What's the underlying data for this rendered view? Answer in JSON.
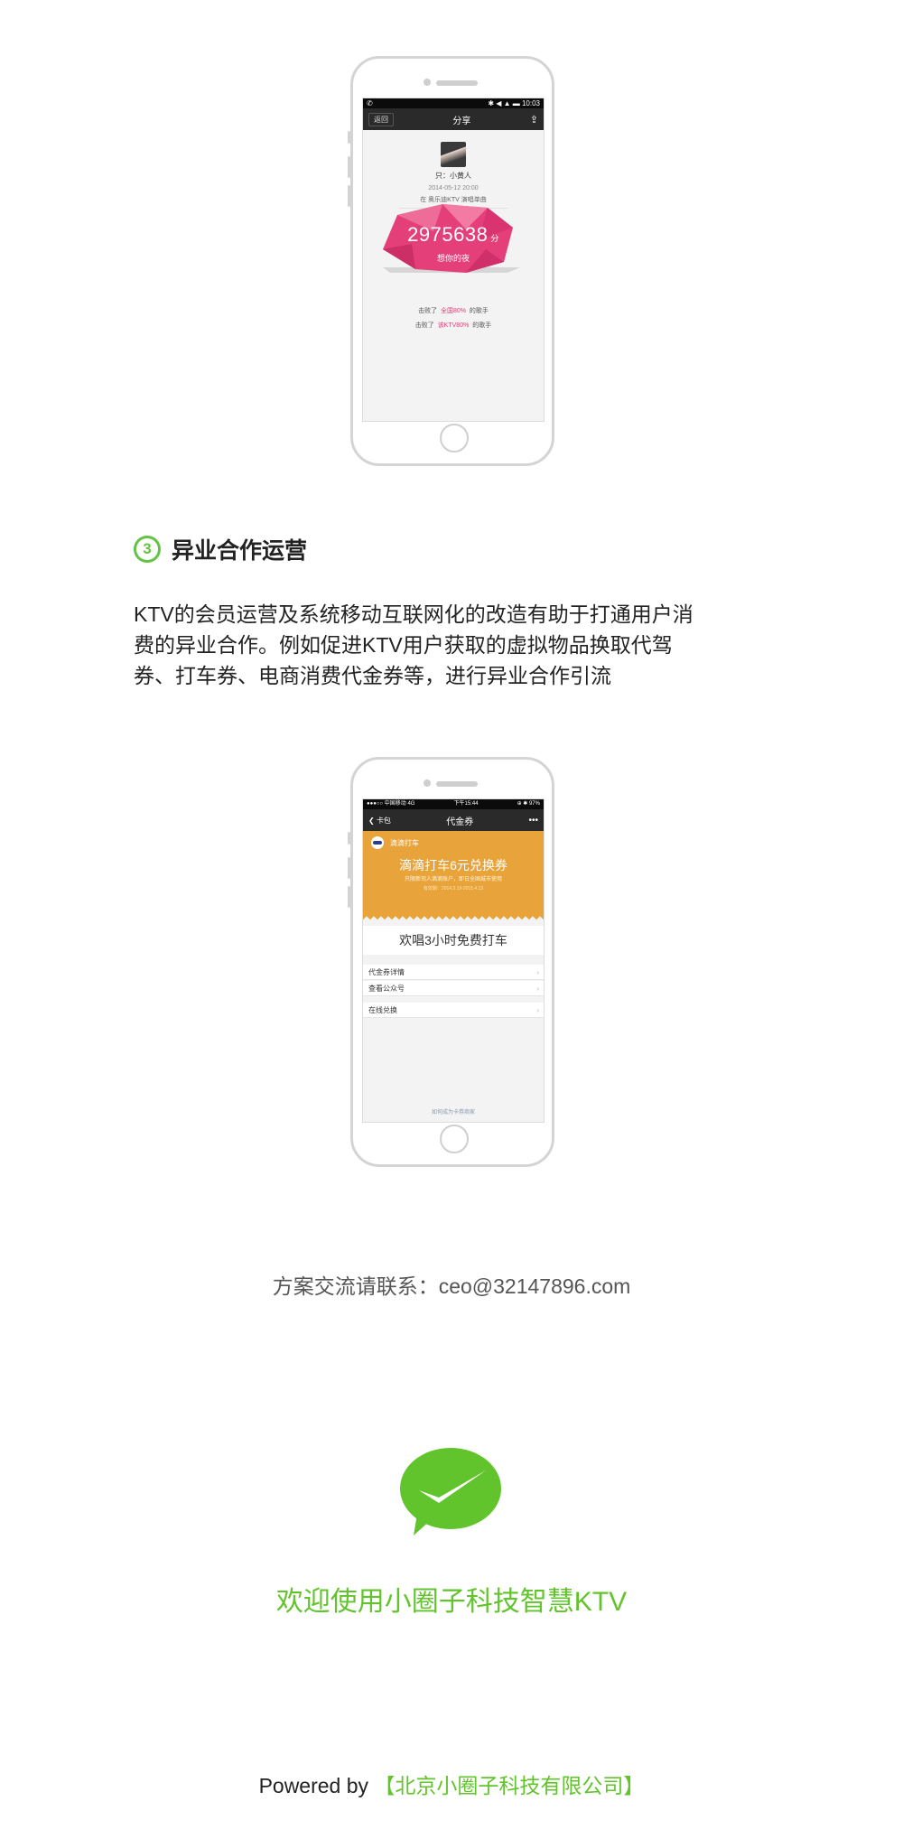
{
  "screen1": {
    "statusbar": {
      "left": "✆",
      "right": "✱ ◀ ▲ ▬ 10:03"
    },
    "nav": {
      "back": "返回",
      "title": "分享"
    },
    "user_name": "只：小黄人",
    "date": "2014-05-12 20:00",
    "venue": "在  奥乐迪KTV  演唱单曲",
    "score": "2975638",
    "score_unit": "分",
    "song": "想你的夜",
    "beat_national_pre": "击败了",
    "beat_national_value": "全国80%",
    "beat_national_post": "的歌手",
    "beat_ktv_pre": "击败了",
    "beat_ktv_value": "该KTV80%",
    "beat_ktv_post": "的歌手"
  },
  "section": {
    "number": "3",
    "title": "异业合作运营",
    "lines": [
      "KTV的会员运营及系统移动互联网化的改造有助于打通用户消",
      "费的异业合作。例如促进KTV用户获取的虚拟物品换取代驾",
      "券、打车券、电商消费代金券等，进行异业合作引流"
    ]
  },
  "screen2": {
    "statusbar": {
      "left": "●●●○○ 中国移动  4G",
      "center": "下午15:44",
      "right": "⊕ ✱ 97%"
    },
    "nav": {
      "back": "卡包",
      "title": "代金券",
      "more": "•••"
    },
    "brand": "滴滴打车",
    "coupon_title": "滴滴打车6元兑换券",
    "coupon_note": "只限新司人滴滴账户，即日全国城市使用",
    "coupon_validity": "有效期：2014.3.19-2015.4.13",
    "card_text": "欢唱3小时免费打车",
    "menu": [
      "代金券详情",
      "查看公众号",
      "在线兑换"
    ],
    "footer_link": "如何成为卡券商家"
  },
  "contact": "方案交流请联系：ceo@32147896.com",
  "welcome": "欢迎使用小圈子科技智慧KTV",
  "powered": {
    "prefix": "Powered by ",
    "company": "【北京小圈子科技有限公司】"
  },
  "colors": {
    "accent_green": "#62c42c",
    "coupon_orange": "#e8a43a",
    "gem_pink": "#e33c78"
  }
}
